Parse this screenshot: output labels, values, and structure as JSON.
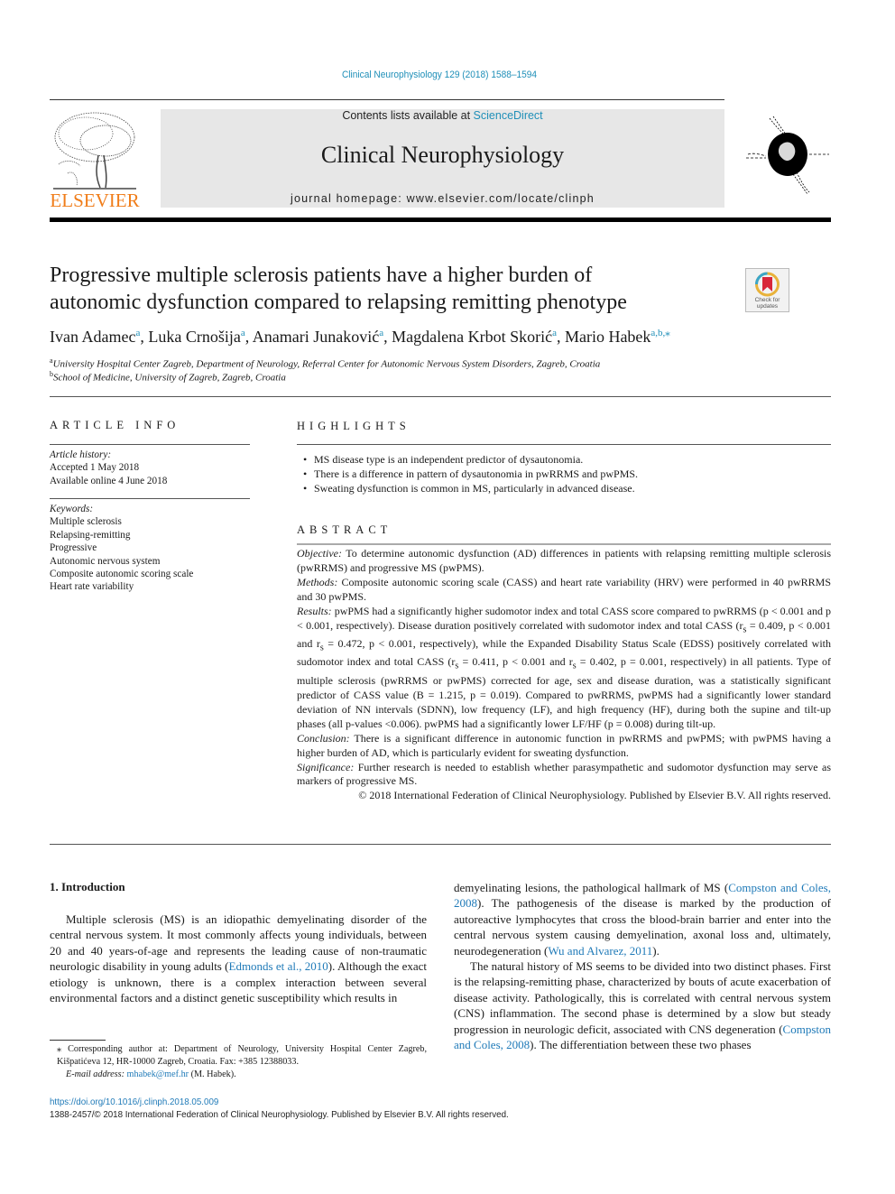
{
  "header": {
    "citation": "Clinical Neurophysiology 129 (2018) 1588–1594",
    "contents_prefix": "Contents lists available at ",
    "contents_link": "ScienceDirect",
    "journal_name": "Clinical Neurophysiology",
    "homepage": "journal homepage: www.elsevier.com/locate/clinph",
    "publisher_logo_text": "ELSEVIER",
    "crossmark_label_1": "Check for",
    "crossmark_label_2": "updates"
  },
  "colors": {
    "link": "#1f7ab8",
    "elsevier_orange": "#f07d1a",
    "banner_gray": "#e7e7e7"
  },
  "article": {
    "title_line_1": "Progressive multiple sclerosis patients have a higher burden of",
    "title_line_2": "autonomic dysfunction compared to relapsing remitting phenotype",
    "authors": [
      {
        "name": "Ivan Adamec",
        "aff": "a"
      },
      {
        "name": "Luka Crnošija",
        "aff": "a"
      },
      {
        "name": "Anamari Junaković",
        "aff": "a"
      },
      {
        "name": "Magdalena Krbot Skorić",
        "aff": "a"
      },
      {
        "name": "Mario Habek",
        "aff": "a,b,⁎"
      }
    ],
    "affiliations": [
      {
        "label": "a",
        "text": "University Hospital Center Zagreb, Department of Neurology, Referral Center for Autonomic Nervous System Disorders, Zagreb, Croatia"
      },
      {
        "label": "b",
        "text": "School of Medicine, University of Zagreb, Zagreb, Croatia"
      }
    ]
  },
  "article_info": {
    "heading": "ARTICLE INFO",
    "history_label": "Article history:",
    "history": [
      "Accepted 1 May 2018",
      "Available online 4 June 2018"
    ],
    "keywords_label": "Keywords:",
    "keywords": [
      "Multiple sclerosis",
      "Relapsing-remitting",
      "Progressive",
      "Autonomic nervous system",
      "Composite autonomic scoring scale",
      "Heart rate variability"
    ]
  },
  "highlights": {
    "heading": "HIGHLIGHTS",
    "items": [
      "MS disease type is an independent predictor of dysautonomia.",
      "There is a difference in pattern of dysautonomia in pwRRMS and pwPMS.",
      "Sweating dysfunction is common in MS, particularly in advanced disease."
    ]
  },
  "abstract": {
    "heading": "ABSTRACT",
    "objective_label": "Objective:",
    "objective": "To determine autonomic dysfunction (AD) differences in patients with relapsing remitting multiple sclerosis (pwRRMS) and progressive MS (pwPMS).",
    "methods_label": "Methods:",
    "methods": "Composite autonomic scoring scale (CASS) and heart rate variability (HRV) were performed in 40 pwRRMS and 30 pwPMS.",
    "results_label": "Results:",
    "results_1": "pwPMS had a significantly higher sudomotor index and total CASS score compared to pwRRMS (p < 0.001 and p < 0.001, respectively). Disease duration positively correlated with sudomotor index and total CASS (r",
    "results_2": " = 0.409, p < 0.001 and r",
    "results_3": " = 0.472, p < 0.001, respectively), while the Expanded Disability Status Scale (EDSS) positively correlated with sudomotor index and total CASS (r",
    "results_4": " = 0.411, p < 0.001 and r",
    "results_5": " = 0.402, p = 0.001, respectively) in all patients. Type of multiple sclerosis (pwRRMS or pwPMS) corrected for age, sex and disease duration, was a statistically significant predictor of CASS value (B = 1.215, p = 0.019). Compared to pwRRMS, pwPMS had a significantly lower standard deviation of NN intervals (SDNN), low frequency (LF), and high frequency (HF), during both the supine and tilt-up phases (all p-values <0.006). pwPMS had a significantly lower LF/HF (p = 0.008) during tilt-up.",
    "subscript_s": "s",
    "conclusion_label": "Conclusion:",
    "conclusion": "There is a significant difference in autonomic function in pwRRMS and pwPMS; with pwPMS having a higher burden of AD, which is particularly evident for sweating dysfunction.",
    "significance_label": "Significance:",
    "significance": "Further research is needed to establish whether parasympathetic and sudomotor dysfunction may serve as markers of progressive MS.",
    "copyright": "© 2018 International Federation of Clinical Neurophysiology. Published by Elsevier B.V. All rights reserved."
  },
  "intro": {
    "heading": "1. Introduction",
    "p1_a": "Multiple sclerosis (MS) is an idiopathic demyelinating disorder of the central nervous system. It most commonly affects young individuals, between 20 and 40 years-of-age and represents the leading cause of non-traumatic neurologic disability in young adults (",
    "p1_ref1": "Edmonds et al., 2010",
    "p1_b": "). Although the exact etiology is unknown, there is a complex interaction between several environmental factors and a distinct genetic susceptibility which results in demyelinating lesions, the pathological hallmark of MS (",
    "p1_ref2": "Compston and Coles, 2008",
    "p1_c": "). The pathogenesis of the disease is marked by the production of autoreactive lymphocytes that cross the blood-brain barrier and enter into the central nervous system causing demyelination, axonal loss and, ultimately, neurodegeneration (",
    "p1_ref3": "Wu and Alvarez, 2011",
    "p1_d": ").",
    "p2_a": "The natural history of MS seems to be divided into two distinct phases. First is the relapsing-remitting phase, characterized by bouts of acute exacerbation of disease activity. Pathologically, this is correlated with central nervous system (CNS) inflammation. The second phase is determined by a slow but steady progression in neurologic deficit, associated with CNS degeneration (",
    "p2_ref1": "Compston and Coles, 2008",
    "p2_b": "). The differentiation between these two phases"
  },
  "footnote": {
    "corresponding": "⁎ Corresponding author at: Department of Neurology, University Hospital Center Zagreb, Kišpatićeva 12, HR-10000 Zagreb, Croatia. Fax: +385 12388033.",
    "email_label": "E-mail address:",
    "email": "mhabek@mef.hr",
    "email_suffix": " (M. Habek)."
  },
  "footer": {
    "doi": "https://doi.org/10.1016/j.clinph.2018.05.009",
    "issn_line": "1388-2457/© 2018 International Federation of Clinical Neurophysiology. Published by Elsevier B.V. All rights reserved."
  }
}
